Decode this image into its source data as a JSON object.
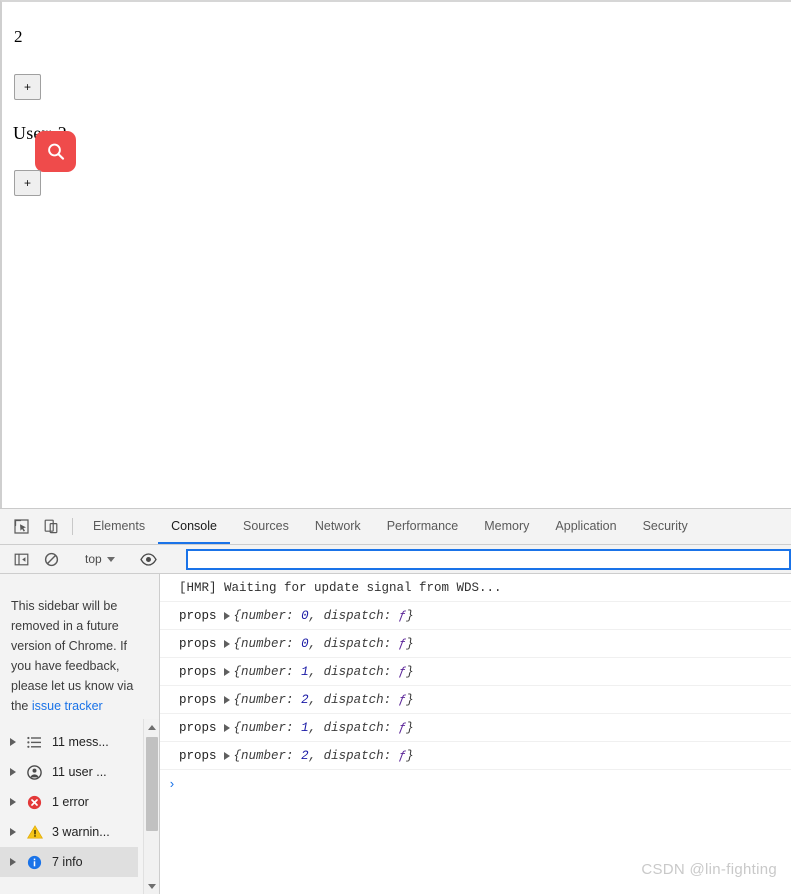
{
  "page": {
    "counter_value": "2",
    "increment_label_1": "+",
    "user_heading": "User: 2",
    "increment_label_2": "+",
    "badge_icon": "search-icon",
    "badge_color": "#ef4b4b"
  },
  "devtools": {
    "inspect_icon": "inspect-element-icon",
    "device_icon": "device-toolbar-icon",
    "tabs": [
      {
        "label": "Elements",
        "active": false
      },
      {
        "label": "Console",
        "active": true
      },
      {
        "label": "Sources",
        "active": false
      },
      {
        "label": "Network",
        "active": false
      },
      {
        "label": "Performance",
        "active": false
      },
      {
        "label": "Memory",
        "active": false
      },
      {
        "label": "Application",
        "active": false
      },
      {
        "label": "Security",
        "active": false
      }
    ],
    "active_tab_accent": "#1a73e8",
    "toolbar": {
      "sidebar_toggle_icon": "sidebar-toggle-icon",
      "clear_console_icon": "clear-console-icon",
      "context_value": "top",
      "eye_icon": "live-expression-icon",
      "filter_value": "",
      "filter_placeholder": ""
    },
    "sidebar": {
      "notice_text": "This sidebar will be removed in a future version of Chrome. If you have feedback, please let us know via the ",
      "notice_link": "issue tracker",
      "items": [
        {
          "icon": "list-icon",
          "label": "11 mess...",
          "selected": false
        },
        {
          "icon": "user-icon",
          "label": "11 user ...",
          "selected": false
        },
        {
          "icon": "error-icon",
          "label": "1 error",
          "selected": false
        },
        {
          "icon": "warning-icon",
          "label": "3 warnin...",
          "selected": false
        },
        {
          "icon": "info-icon",
          "label": "7 info",
          "selected": true
        }
      ]
    },
    "console": {
      "messages": [
        {
          "label": "",
          "text": "[HMR] Waiting for update signal from WDS...",
          "object": null
        },
        {
          "label": "props",
          "text": "",
          "object": {
            "number": "0",
            "dispatch": "ƒ"
          }
        },
        {
          "label": "props",
          "text": "",
          "object": {
            "number": "0",
            "dispatch": "ƒ"
          }
        },
        {
          "label": "props",
          "text": "",
          "object": {
            "number": "1",
            "dispatch": "ƒ"
          }
        },
        {
          "label": "props",
          "text": "",
          "object": {
            "number": "2",
            "dispatch": "ƒ"
          }
        },
        {
          "label": "props",
          "text": "",
          "object": {
            "number": "1",
            "dispatch": "ƒ"
          }
        },
        {
          "label": "props",
          "text": "",
          "object": {
            "number": "2",
            "dispatch": "ƒ"
          }
        }
      ],
      "prompt_symbol": "›"
    }
  },
  "watermark": {
    "text": "CSDN @lin-fighting"
  }
}
